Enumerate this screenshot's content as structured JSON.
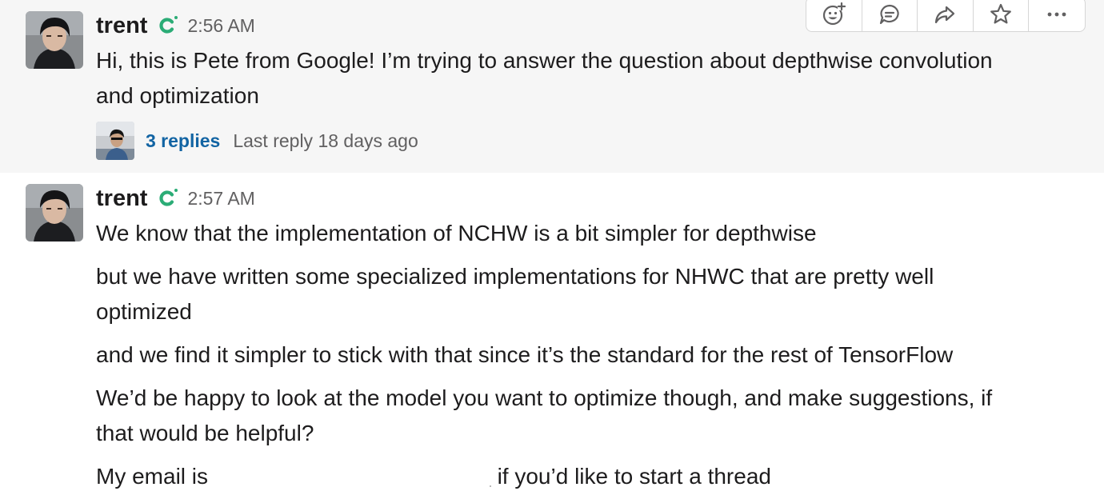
{
  "messages": [
    {
      "author": "trent",
      "app_badge_icon": "app-c-icon",
      "timestamp": "2:56 AM",
      "lines": [
        "Hi, this is Pete from Google! I’m trying to answer the question about depthwise convolution",
        "and optimization"
      ],
      "thread": {
        "reply_count": "3 replies",
        "last_reply": "Last reply 18 days ago"
      }
    },
    {
      "author": "trent",
      "app_badge_icon": "app-c-icon",
      "timestamp": "2:57 AM",
      "lines": [
        "We know that the implementation of NCHW is a bit simpler for depthwise",
        "but we have written some specialized implementations for NHWC that are pretty well",
        "optimized",
        "and we find it simpler to stick with that since it’s the standard for the rest of TensorFlow",
        "We’d be happy to look at the model you want to optimize though, and make suggestions, if",
        "that would be helpful?"
      ],
      "email_line": {
        "prefix": "My email is",
        "suffix": "if you’d like to start a thread"
      }
    }
  ],
  "message_actions": [
    {
      "name": "add-reaction",
      "icon": "emoji-add-icon"
    },
    {
      "name": "start-thread",
      "icon": "comment-icon"
    },
    {
      "name": "share-message",
      "icon": "share-arrow-icon"
    },
    {
      "name": "add-to-saved",
      "icon": "star-icon"
    },
    {
      "name": "more-actions",
      "icon": "more-dots-icon"
    }
  ],
  "colors": {
    "hover_background": "#f6f6f6",
    "link": "#1264a3",
    "muted_text": "#616061",
    "app_badge": "#2bac76"
  }
}
